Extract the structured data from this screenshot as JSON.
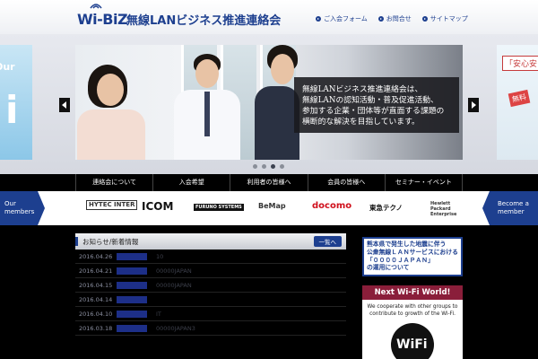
{
  "header": {
    "logo_text": "Wi-BiZ",
    "org_name": "無線LANビジネス推進連絡会",
    "links": [
      "ご入会フォーム",
      "お問合せ",
      "サイトマップ"
    ]
  },
  "hero": {
    "caption": "無線LANビジネス推進連絡会は、\n無線LANの認知活動・普及促進活動、\n参加する企業・団体等が直面する課題の\n横断的な解決を目指しています。",
    "left_partial": {
      "line1": "Our",
      "big_letter": "i"
    },
    "right_partial": {
      "badge": "「安心安",
      "tag": "無料"
    },
    "slide_count": 4,
    "active_slide": 2
  },
  "nav": {
    "items": [
      "連絡会について",
      "入会希望",
      "利用者の皆様へ",
      "会員の皆様へ",
      "セミナー・イベント"
    ]
  },
  "members": {
    "left_label": "Our\nmembers",
    "right_label": "Become a\nmember",
    "logos": [
      "HYTEC INTER",
      "ICOM",
      "FURUNO SYSTEMS",
      "BeMap",
      "docomo",
      "東急テクノ",
      "Hewlett Packard Enterprise"
    ]
  },
  "news": {
    "title": "お知らせ/新着情報",
    "more_label": "一覧へ",
    "rows": [
      {
        "date": "2016.04.26",
        "text": "10"
      },
      {
        "date": "2016.04.21",
        "text": "00000JAPAN"
      },
      {
        "date": "2016.04.15",
        "text": "00000JAPAN"
      },
      {
        "date": "2016.04.14",
        "text": ""
      },
      {
        "date": "2016.04.10",
        "text": "IT"
      },
      {
        "date": "2016.03.18",
        "text": "00000JAPAN3"
      }
    ]
  },
  "sidebar": {
    "banner": "熊本県で発生した地震に伴う\n公衆無線ＬＡＮサービスにおける\n「００００ＪＡＰＡＮ」\nの運用について",
    "next_title": "Next Wi-Fi World!",
    "next_text": "We cooperate with other groups to\ncontribute to growth of the Wi-Fi.",
    "wifi_logo": "WiFi"
  },
  "colors": {
    "brand": "#1d3f8f",
    "nav_bg": "#000000",
    "next_title_bg": "#8a1e3a"
  }
}
